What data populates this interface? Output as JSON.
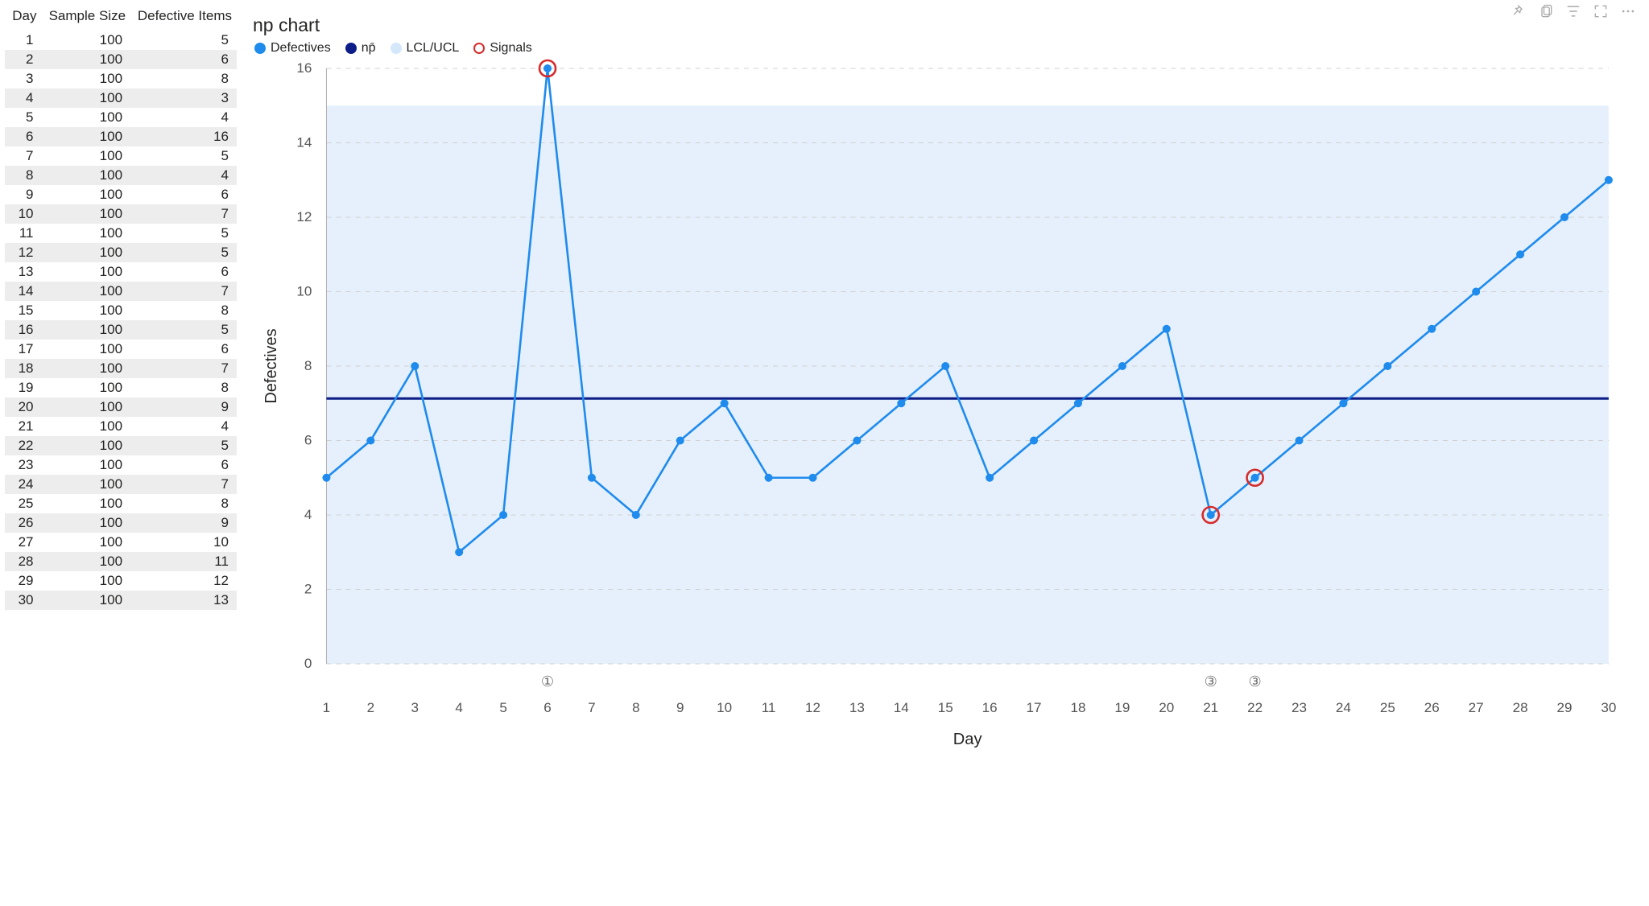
{
  "chart_data": {
    "type": "line",
    "title": "np chart",
    "xlabel": "Day",
    "ylabel": "Defectives",
    "xlim": [
      1,
      30
    ],
    "ylim": [
      0,
      16
    ],
    "x_ticks": [
      1,
      2,
      3,
      4,
      5,
      6,
      7,
      8,
      9,
      10,
      11,
      12,
      13,
      14,
      15,
      16,
      17,
      18,
      19,
      20,
      21,
      22,
      23,
      24,
      25,
      26,
      27,
      28,
      29,
      30
    ],
    "y_ticks": [
      0,
      2,
      4,
      6,
      8,
      10,
      12,
      14,
      16
    ],
    "lcl": 0,
    "ucl": 15,
    "np_bar": 7.13,
    "series": [
      {
        "name": "Defectives",
        "x": [
          1,
          2,
          3,
          4,
          5,
          6,
          7,
          8,
          9,
          10,
          11,
          12,
          13,
          14,
          15,
          16,
          17,
          18,
          19,
          20,
          21,
          22,
          23,
          24,
          25,
          26,
          27,
          28,
          29,
          30
        ],
        "y": [
          5,
          6,
          8,
          3,
          4,
          16,
          5,
          4,
          6,
          7,
          5,
          5,
          6,
          7,
          8,
          5,
          6,
          7,
          8,
          9,
          4,
          5,
          6,
          7,
          8,
          9,
          10,
          11,
          12,
          13
        ]
      }
    ],
    "signals": [
      {
        "day": 6,
        "value": 16,
        "rule": "①"
      },
      {
        "day": 21,
        "value": 4,
        "rule": "③"
      },
      {
        "day": 22,
        "value": 5,
        "rule": "③"
      }
    ],
    "legend": [
      "Defectives",
      "np̄",
      "LCL/UCL",
      "Signals"
    ]
  },
  "table": {
    "columns": [
      "Day",
      "Sample Size",
      "Defective Items"
    ],
    "rows": [
      [
        1,
        100,
        5
      ],
      [
        2,
        100,
        6
      ],
      [
        3,
        100,
        8
      ],
      [
        4,
        100,
        3
      ],
      [
        5,
        100,
        4
      ],
      [
        6,
        100,
        16
      ],
      [
        7,
        100,
        5
      ],
      [
        8,
        100,
        4
      ],
      [
        9,
        100,
        6
      ],
      [
        10,
        100,
        7
      ],
      [
        11,
        100,
        5
      ],
      [
        12,
        100,
        5
      ],
      [
        13,
        100,
        6
      ],
      [
        14,
        100,
        7
      ],
      [
        15,
        100,
        8
      ],
      [
        16,
        100,
        5
      ],
      [
        17,
        100,
        6
      ],
      [
        18,
        100,
        7
      ],
      [
        19,
        100,
        8
      ],
      [
        20,
        100,
        9
      ],
      [
        21,
        100,
        4
      ],
      [
        22,
        100,
        5
      ],
      [
        23,
        100,
        6
      ],
      [
        24,
        100,
        7
      ],
      [
        25,
        100,
        8
      ],
      [
        26,
        100,
        9
      ],
      [
        27,
        100,
        10
      ],
      [
        28,
        100,
        11
      ],
      [
        29,
        100,
        12
      ],
      [
        30,
        100,
        13
      ]
    ]
  },
  "toolbar": {
    "pin": "Pin",
    "copy": "Copy",
    "filter": "Filter",
    "focus": "Focus mode",
    "more": "More options"
  },
  "colors": {
    "defectives": "#1f8bed",
    "npbar": "#0c1d88",
    "band": "#e2eefc",
    "signal": "#d62c2c"
  }
}
